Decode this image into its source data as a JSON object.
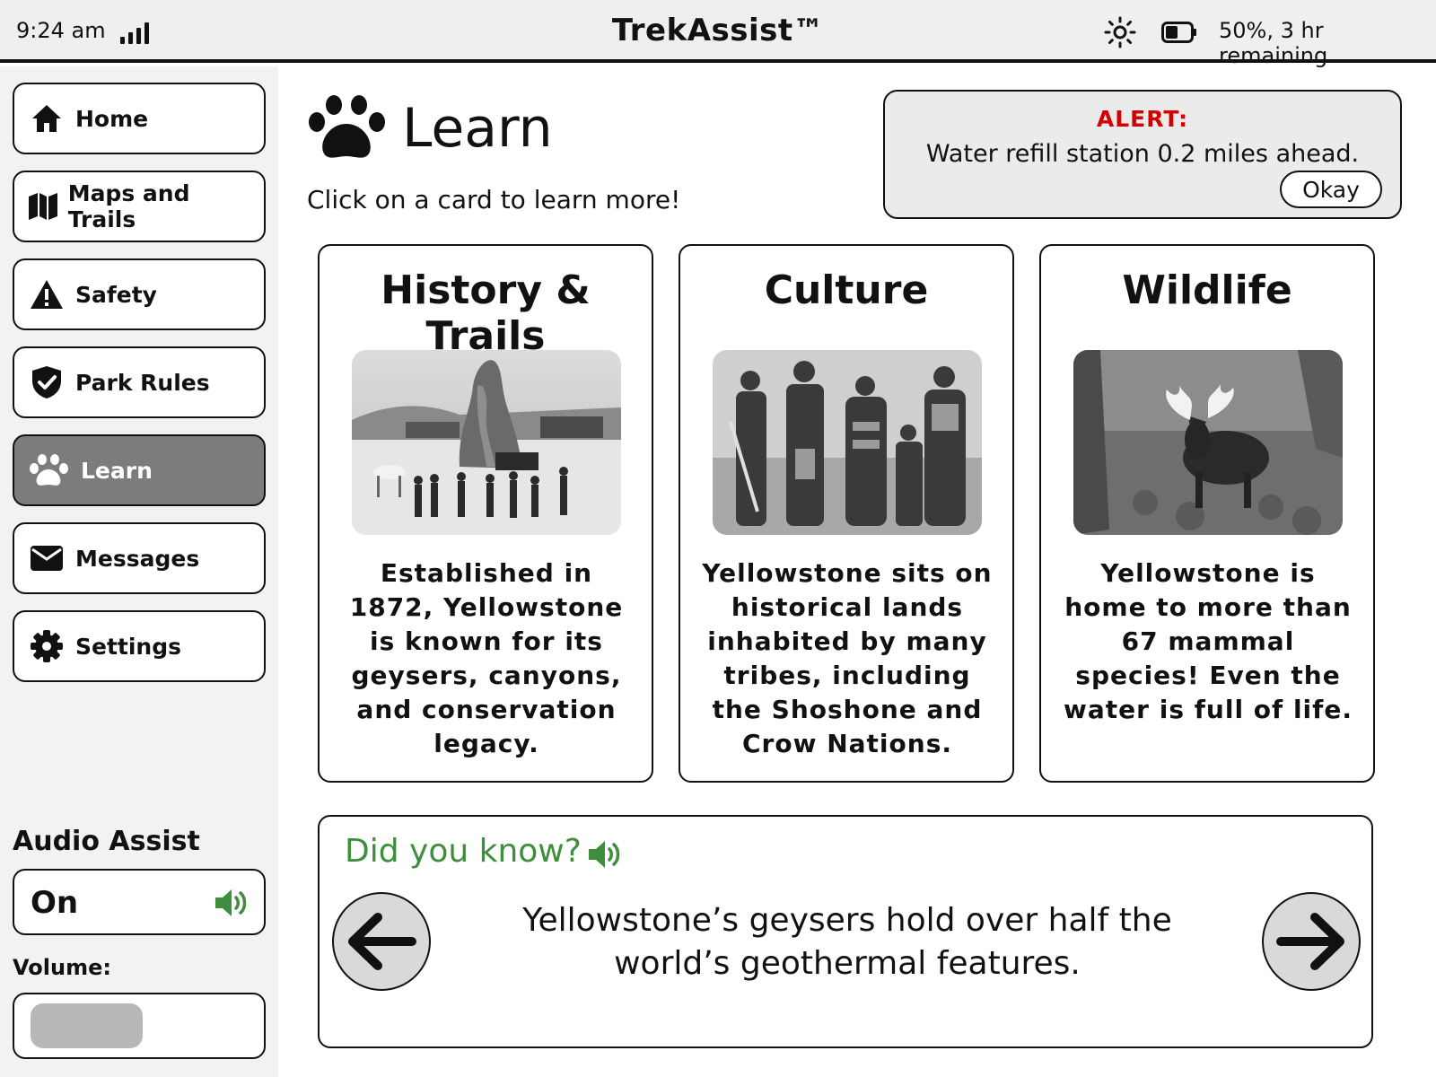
{
  "status_bar": {
    "time": "9:24 am",
    "app_title": "TrekAssist™",
    "battery_text": "50%, 3 hr remaining",
    "battery_level": 0.5
  },
  "sidebar": {
    "items": [
      {
        "label": "Home",
        "icon": "home-icon"
      },
      {
        "label": "Maps and Trails",
        "icon": "map-icon"
      },
      {
        "label": "Safety",
        "icon": "warning-icon"
      },
      {
        "label": "Park Rules",
        "icon": "shield-check-icon"
      },
      {
        "label": "Learn",
        "icon": "paw-icon",
        "active": true
      },
      {
        "label": "Messages",
        "icon": "envelope-icon"
      },
      {
        "label": "Settings",
        "icon": "gear-icon"
      }
    ],
    "audio_assist": {
      "title": "Audio Assist",
      "state": "On",
      "volume_label": "Volume:",
      "volume_level": 0.45
    }
  },
  "main": {
    "title": "Learn",
    "subtitle": "Click on a card to learn more!",
    "alert": {
      "label": "ALERT:",
      "message": "Water refill station 0.2 miles ahead.",
      "button": "Okay"
    },
    "cards": [
      {
        "title": "History & Trails",
        "text": "Established in 1872, Yellowstone is known for its geysers, canyons, and conservation legacy."
      },
      {
        "title": "Culture",
        "text": "Yellowstone sits on historical lands inhabited by many tribes, including the Shoshone and Crow Nations."
      },
      {
        "title": "Wildlife",
        "text": "Yellowstone is home to more than 67 mammal species! Even the water is full of life."
      }
    ],
    "did_you_know": {
      "title": "Did you know?",
      "fact": "Yellowstone’s geysers hold over half the world’s geothermal features."
    }
  },
  "colors": {
    "alert_red": "#d40000",
    "accent_green": "#3e8e3e",
    "active_nav": "#7c7c7c"
  }
}
